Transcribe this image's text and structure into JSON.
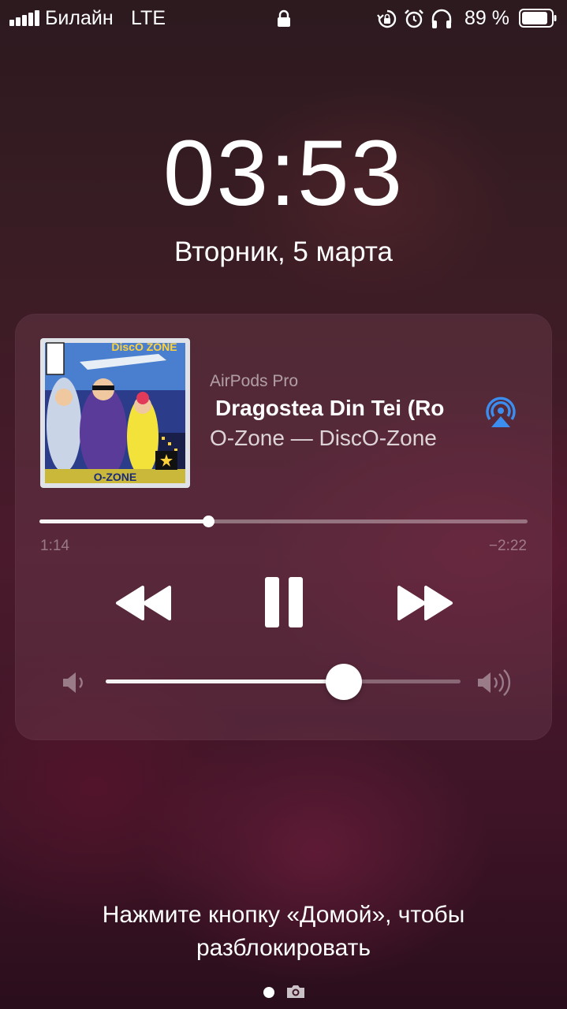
{
  "status_bar": {
    "carrier": "Билайн",
    "network": "LTE",
    "battery_percent": "89 %",
    "battery_level": 0.89,
    "icons": [
      "signal-icon",
      "lock-icon",
      "rotation-lock-icon",
      "alarm-icon",
      "headphones-icon",
      "battery-icon"
    ]
  },
  "clock": {
    "time": "03:53",
    "date": "Вторник, 5 марта"
  },
  "now_playing": {
    "output_device": "AirPods Pro",
    "title": "Dragostea Din Tei (Ro",
    "subtitle": "O-Zone — DiscO-Zone",
    "album_art_text": {
      "top": "DiscO ZONE",
      "bottom": "O-ZONE"
    },
    "elapsed": "1:14",
    "remaining": "−2:22",
    "progress_fraction": 0.345,
    "volume_fraction": 0.67,
    "controls": [
      "rewind-icon",
      "pause-icon",
      "fast-forward-icon"
    ],
    "airplay_icon": "airplay-icon",
    "airplay_color": "#3b8ef0"
  },
  "unlock_hint": {
    "line1": "Нажмите кнопку «Домой», чтобы",
    "line2": "разблокировать"
  },
  "page_indicator": {
    "icons": [
      "page-dot-icon",
      "camera-icon"
    ]
  }
}
